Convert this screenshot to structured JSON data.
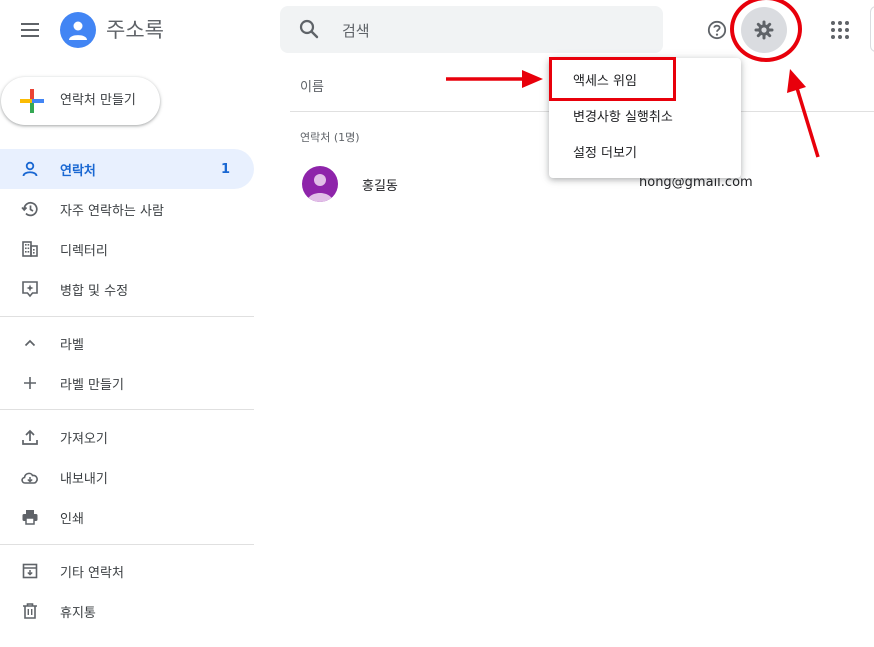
{
  "header": {
    "app_title": "주소록",
    "search_placeholder": "검색",
    "icons": [
      "menu-icon",
      "contacts-logo",
      "search-icon",
      "help-icon",
      "settings-gear-icon",
      "apps-grid-icon"
    ]
  },
  "settings_menu": {
    "items": [
      "액세스 위임",
      "변경사항 실행취소",
      "설정 더보기"
    ]
  },
  "sidebar": {
    "create_label": "연락처 만들기",
    "items": [
      {
        "label": "연락처",
        "count": "1",
        "icon": "person-icon",
        "active": true
      },
      {
        "label": "자주 연락하는 사람",
        "icon": "history-icon"
      },
      {
        "label": "디렉터리",
        "icon": "building-icon"
      },
      {
        "label": "병합 및 수정",
        "icon": "merge-fix-icon"
      },
      {
        "label": "라벨",
        "icon": "chevron-up-icon"
      },
      {
        "label": "라벨 만들기",
        "icon": "plus-icon"
      },
      {
        "label": "가져오기",
        "icon": "upload-icon"
      },
      {
        "label": "내보내기",
        "icon": "cloud-download-icon"
      },
      {
        "label": "인쇄",
        "icon": "print-icon"
      },
      {
        "label": "기타 연락처",
        "icon": "archive-icon"
      },
      {
        "label": "휴지통",
        "icon": "trash-icon"
      }
    ]
  },
  "main": {
    "column_header": "이름",
    "section_label": "연락처 (1명)",
    "contacts": [
      {
        "name": "홍길동",
        "email": "hong@gmail.com"
      }
    ]
  },
  "colors": {
    "accent": "#1967d2",
    "active_bg": "#e8f0fe",
    "annotation_red": "#e8000b",
    "avatar_purple": "#8e24aa"
  }
}
